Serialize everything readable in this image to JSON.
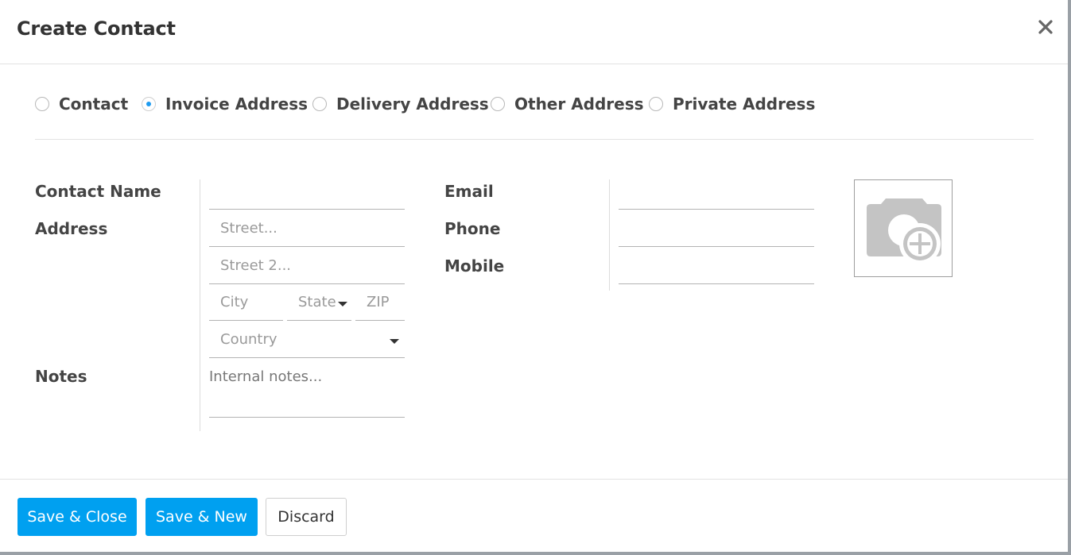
{
  "modal": {
    "title": "Create Contact",
    "close_icon": "close-icon"
  },
  "contact_types": [
    {
      "label": "Contact",
      "checked": false
    },
    {
      "label": "Invoice Address",
      "checked": true
    },
    {
      "label": "Delivery Address",
      "checked": false
    },
    {
      "label": "Other Address",
      "checked": false
    },
    {
      "label": "Private Address",
      "checked": false
    }
  ],
  "form": {
    "contact_name_label": "Contact Name",
    "contact_name_value": "",
    "address_label": "Address",
    "street_placeholder": "Street...",
    "street2_placeholder": "Street 2...",
    "city_placeholder": "City",
    "state_placeholder": "State",
    "zip_placeholder": "ZIP",
    "country_placeholder": "Country",
    "notes_label": "Notes",
    "notes_placeholder": "Internal notes...",
    "email_label": "Email",
    "email_value": "",
    "phone_label": "Phone",
    "phone_value": "",
    "mobile_label": "Mobile",
    "mobile_value": "",
    "avatar_icon": "camera-plus-icon"
  },
  "footer": {
    "save_close_label": "Save & Close",
    "save_new_label": "Save & New",
    "discard_label": "Discard"
  },
  "colors": {
    "primary": "#00a0f0",
    "radio_accent": "#1e9bf0",
    "text": "#444444"
  }
}
